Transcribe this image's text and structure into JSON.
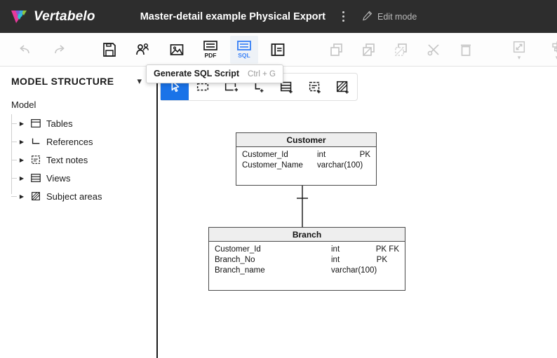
{
  "header": {
    "brand": "Vertabelo",
    "brand_logo_icon": "vertabelo-v-logo",
    "doc_title": "Master-detail example Physical Export",
    "kebab_icon": "more-vertical-icon",
    "edit_mode_label": "Edit mode",
    "edit_mode_icon": "pencil-icon",
    "bg_color": "#2d2d2d"
  },
  "toolbar": {
    "history": [
      {
        "name": "undo-button",
        "icon": "undo-arrow-icon",
        "disabled": true
      },
      {
        "name": "redo-button",
        "icon": "redo-arrow-icon",
        "disabled": true
      }
    ],
    "file": [
      {
        "name": "save-button",
        "icon": "floppy-disk-icon",
        "disabled": false
      },
      {
        "name": "share-button",
        "icon": "people-share-icon",
        "disabled": false
      },
      {
        "name": "export-image-button",
        "icon": "image-icon",
        "disabled": false
      },
      {
        "name": "export-pdf-button",
        "icon": "pdf-icon",
        "label": "PDF",
        "disabled": false
      },
      {
        "name": "generate-sql-button",
        "icon": "sql-icon",
        "label": "SQL",
        "active": true,
        "accent": "#3b82f6"
      },
      {
        "name": "documentation-button",
        "icon": "document-panel-icon",
        "disabled": false
      }
    ],
    "clipboard": [
      {
        "name": "copy-button",
        "icon": "copy-icon",
        "disabled": true
      },
      {
        "name": "paste-button",
        "icon": "paste-icon",
        "disabled": true
      },
      {
        "name": "paste-special-button",
        "icon": "paste-special-icon",
        "disabled": true
      },
      {
        "name": "cut-button",
        "icon": "scissors-icon",
        "disabled": true
      },
      {
        "name": "delete-button",
        "icon": "trash-icon",
        "disabled": true
      }
    ],
    "arrange": [
      {
        "name": "resize-button",
        "icon": "resize-diagonal-icon",
        "disabled": true,
        "caret": true
      },
      {
        "name": "align-horizontal-button",
        "icon": "align-horizontal-icon",
        "disabled": true,
        "caret": true
      },
      {
        "name": "align-vertical-button",
        "icon": "align-vertical-icon",
        "disabled": true,
        "caret": true
      },
      {
        "name": "layers-button",
        "icon": "layers-icon",
        "disabled": true,
        "caret": true
      },
      {
        "name": "line-routing-button",
        "icon": "line-routing-icon",
        "disabled": true,
        "caret": true
      }
    ]
  },
  "tooltip": {
    "label": "Generate SQL Script",
    "shortcut": "Ctrl + G"
  },
  "canvas_toolbar": {
    "accent": "#1a73e8",
    "tools": [
      {
        "name": "select-tool",
        "icon": "cursor-arrow-icon",
        "selected": true
      },
      {
        "name": "marquee-select-tool",
        "icon": "marquee-select-icon",
        "selected": false
      },
      {
        "name": "add-table-tool",
        "icon": "add-table-icon",
        "selected": false
      },
      {
        "name": "add-reference-tool",
        "icon": "add-reference-icon",
        "selected": false
      },
      {
        "name": "add-view-tool",
        "icon": "add-view-icon",
        "selected": false
      },
      {
        "name": "add-note-tool",
        "icon": "add-note-icon",
        "selected": false
      },
      {
        "name": "add-subject-area-tool",
        "icon": "add-subject-area-icon",
        "selected": false
      }
    ]
  },
  "sidebar": {
    "title": "MODEL STRUCTURE",
    "collapse_icon": "chevron-down-icon",
    "root_label": "Model",
    "items": [
      {
        "label": "Tables",
        "icon": "table-icon",
        "expander": "triangle-right-icon"
      },
      {
        "label": "References",
        "icon": "reference-icon",
        "expander": "triangle-right-icon"
      },
      {
        "label": "Text notes",
        "icon": "note-icon",
        "expander": "triangle-right-icon"
      },
      {
        "label": "Views",
        "icon": "view-icon",
        "expander": "triangle-right-icon"
      },
      {
        "label": "Subject areas",
        "icon": "subject-area-icon",
        "expander": "triangle-right-icon"
      }
    ]
  },
  "diagram": {
    "tables": [
      {
        "name": "Customer",
        "columns": [
          {
            "name": "Customer_Id",
            "type": "int",
            "key": "PK"
          },
          {
            "name": "Customer_Name",
            "type": "varchar(100)",
            "key": ""
          }
        ]
      },
      {
        "name": "Branch",
        "columns": [
          {
            "name": "Customer_Id",
            "type": "int",
            "key": "PK FK"
          },
          {
            "name": "Branch_No",
            "type": "int",
            "key": "PK"
          },
          {
            "name": "Branch_name",
            "type": "varchar(100)",
            "key": ""
          }
        ]
      }
    ],
    "relationship": {
      "name": "customer-branch-reference",
      "from": "Customer",
      "to": "Branch",
      "from_cardinality": "one",
      "to_cardinality": "many"
    }
  }
}
